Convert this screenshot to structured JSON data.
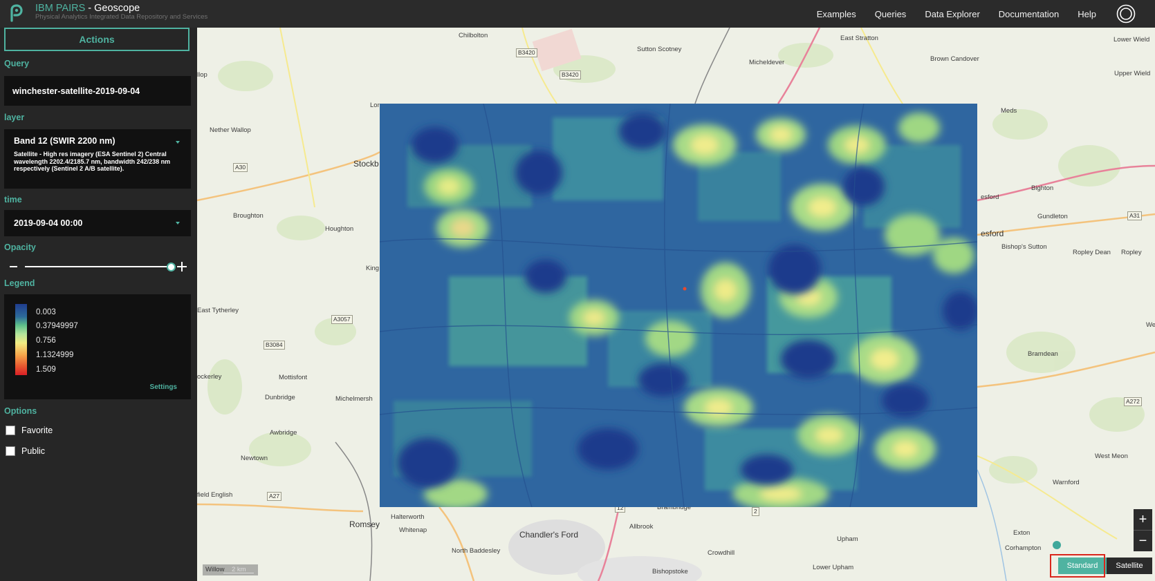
{
  "header": {
    "brand_prefix": "IBM PAIRS",
    "brand_suffix": " - Geoscope",
    "subtitle": "Physical Analytics Integrated Data Repository and Services",
    "nav": [
      "Examples",
      "Queries",
      "Data Explorer",
      "Documentation",
      "Help"
    ],
    "icons": {
      "logo": "pairs-logo-icon",
      "user": "user-avatar-icon"
    }
  },
  "sidebar": {
    "actions_label": "Actions",
    "query": {
      "label": "Query",
      "value": "winchester-satellite-2019-09-04"
    },
    "layer": {
      "label": "layer",
      "selected": "Band 12 (SWIR 2200 nm)",
      "description": "Satellite - High res imagery (ESA Sentinel 2) Central wavelength 2202.4/2185.7 nm, bandwidth 242/238 nm respectively (Sentinel 2 A/B satellite)."
    },
    "time": {
      "label": "time",
      "selected": "2019-09-04 00:00"
    },
    "opacity": {
      "label": "Opacity",
      "value": 1.0
    },
    "legend": {
      "label": "Legend",
      "values": [
        "0.003",
        "0.37949997",
        "0.756",
        "1.1324999",
        "1.509"
      ],
      "colors": [
        "#1f3d8f",
        "#5ec08a",
        "#f2ec83",
        "#f6a54a",
        "#d91f26"
      ],
      "settings_label": "Settings"
    },
    "options": {
      "label": "Options",
      "items": [
        {
          "label": "Favorite",
          "checked": false
        },
        {
          "label": "Public",
          "checked": false
        }
      ]
    }
  },
  "map": {
    "places": {
      "chilbolton": "Chilbolton",
      "sutton_scotney": "Sutton Scotney",
      "east_stratton": "East Stratton",
      "lower_wield": "Lower Wield",
      "micheldever": "Micheldever",
      "brown_candover": "Brown Candover",
      "upper_wield": "Upper Wield",
      "nether_wallop": "Nether Wallop",
      "stockbridge": "Stockb",
      "broughton": "Broughton",
      "houghton": "Houghton",
      "kings": "King",
      "bighton": "Bighton",
      "gundleton": "Gundleton",
      "alresford_small": "esford",
      "alresford_big": "esford",
      "bishops_sutton": "Bishop's Sutton",
      "ropley_dean": "Ropley Dean",
      "ropley": "Ropley",
      "meds": "Meds",
      "east_tytherley": "East Tytherley",
      "west_tisted": "West Tis",
      "bramdean": "Bramdean",
      "lockerley": "ockerley",
      "mottisfont": "Mottisfont",
      "dunbridge": "Dunbridge",
      "michelmersh": "Michelmersh",
      "awbridge": "Awbridge",
      "newtown": "Newtown",
      "west_meon": "West Meon",
      "warnford": "Warnford",
      "sherfield": "field English",
      "romsey": "Romsey",
      "halterworth": "Halterworth",
      "whitenap": "Whitenap",
      "chandlers_ford": "Chandler's Ford",
      "brambridge": "Brambridge",
      "allbrook": "Allbrook",
      "upham": "Upham",
      "north_baddesley": "North Baddesley",
      "crowdhill": "Crowdhill",
      "bishopstoke": "Bishopstoke",
      "lower_upham": "Lower Upham",
      "exton": "Exton",
      "corhampton": "Corhampton",
      "lop": "llop",
      "lor": "Lor"
    },
    "roads": {
      "b3420_a": "B3420",
      "b3420_b": "B3420",
      "a30": "A30",
      "a3057": "A3057",
      "b3084": "B3084",
      "a31": "A31",
      "a272": "A272",
      "a27": "A27",
      "num_12": "12",
      "num_2": "2"
    },
    "overlay_layer": "Band 12 (SWIR 2200 nm)",
    "scale_word": "Willow",
    "scale_label": "2 km",
    "zoom_in": "+",
    "zoom_out": "−",
    "basemap": {
      "standard": "Standard",
      "satellite": "Satellite",
      "active": "Standard"
    }
  }
}
